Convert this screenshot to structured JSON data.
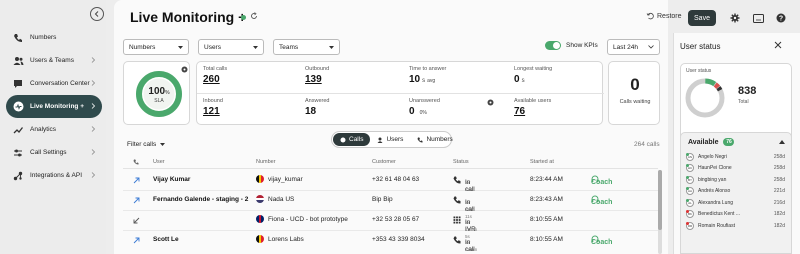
{
  "sidebar": {
    "items": [
      {
        "label": "Numbers",
        "icon": "phone-icon",
        "chevron": false
      },
      {
        "label": "Users & Teams",
        "icon": "users-icon",
        "chevron": true
      },
      {
        "label": "Conversation Center",
        "icon": "chat-icon",
        "chevron": true
      },
      {
        "label": "Live Monitoring +",
        "icon": "monitor-icon",
        "chevron": true,
        "active": true
      },
      {
        "label": "Analytics",
        "icon": "chart-icon",
        "chevron": true
      },
      {
        "label": "Call Settings",
        "icon": "sliders-icon",
        "chevron": true
      },
      {
        "label": "Integrations & API",
        "icon": "integrations-icon",
        "chevron": true
      }
    ]
  },
  "header": {
    "title": "Live Monitoring +",
    "restore_label": "Restore",
    "save_label": "Save"
  },
  "filters": {
    "numbers": "Numbers",
    "users": "Users",
    "teams": "Teams",
    "show_kpis": "Show KPIs",
    "period": "Last 24h"
  },
  "kpis": {
    "sla_value": "100",
    "sla_unit": "%",
    "sla_label": "SLA",
    "total_calls_label": "Total calls",
    "total_calls": "260",
    "outbound_label": "Outbound",
    "outbound": "139",
    "time_to_answer_label": "Time to answer",
    "time_to_answer": "10",
    "time_to_answer_unit": "s",
    "time_to_answer_suffix": "avg",
    "longest_waiting_label": "Longest waiting",
    "longest_waiting": "0",
    "longest_waiting_unit": "s",
    "calls_waiting": "0",
    "calls_waiting_label": "Calls waiting",
    "inbound_label": "Inbound",
    "inbound": "121",
    "answered_label": "Answered",
    "answered": "18",
    "unanswered_label": "Unanswered",
    "unanswered": "0",
    "unanswered_pct": "0%",
    "available_users_label": "Available users",
    "available_users": "76"
  },
  "segments": {
    "calls": "Calls",
    "users": "Users",
    "numbers": "Numbers"
  },
  "table": {
    "filter_label": "Filter calls",
    "count": "264 calls",
    "columns": [
      "User",
      "Number",
      "Customer",
      "Status",
      "Started at"
    ],
    "coach_label": "Coach",
    "rows": [
      {
        "direction": "outbound",
        "user": "Vijay Kumar",
        "number": "vijay_kumar",
        "flag": "be",
        "customer": "+32 61 48 04 63",
        "status": "In call",
        "status_sub": "for 13s",
        "status_type": "call",
        "started": "8:23:44 AM",
        "coach": true
      },
      {
        "direction": "outbound",
        "user": "Fernando Galende - staging - 2",
        "number": "Nada US",
        "flag": "us",
        "customer": "Bip Bip",
        "status": "In call",
        "status_sub": "for 1min 11s",
        "status_type": "call",
        "started": "8:23:43 AM",
        "coach": true
      },
      {
        "direction": "inbound",
        "user": "",
        "number": "Fiona - UCD - bot prototype",
        "flag": "gb",
        "customer": "+32 53 28 05 67",
        "status": "In IVR",
        "status_sub": "for 13min 5s",
        "status_type": "ivr",
        "started": "8:10:55 AM",
        "coach": false
      },
      {
        "direction": "outbound",
        "user": "Scott Le",
        "number": "Lorens Labs",
        "flag": "be",
        "customer": "+353 43 339 8034",
        "status": "In call",
        "status_sub": "for 13min 4s",
        "status_type": "call",
        "started": "8:10:55 AM",
        "coach": true
      }
    ]
  },
  "user_status": {
    "title": "User status",
    "card_label": "User status",
    "total": "838",
    "total_label": "Total",
    "available_label": "Available",
    "available_count": "76",
    "agents": [
      {
        "initials": "AN",
        "name": "Angelo Negri",
        "time": "258d",
        "busy": false
      },
      {
        "initials": "HC",
        "name": "HaunPei Clone",
        "time": "258d",
        "busy": false
      },
      {
        "initials": "BY",
        "name": "bingbing yan",
        "time": "258d",
        "busy": false
      },
      {
        "initials": "AA",
        "name": "Andrés Alonso",
        "time": "221d",
        "busy": false
      },
      {
        "initials": "AL",
        "name": "Alexandra Lung",
        "time": "216d",
        "busy": false
      },
      {
        "initials": "BK",
        "name": "Benedictus Kent ...",
        "time": "182d",
        "busy": true
      },
      {
        "initials": "RR",
        "name": "Romain Roufiast",
        "time": "182d",
        "busy": true
      }
    ]
  },
  "colors": {
    "accent_green": "#4aa86c",
    "dark": "#2e3a3b",
    "sidebar_active": "#2f4a4c"
  }
}
